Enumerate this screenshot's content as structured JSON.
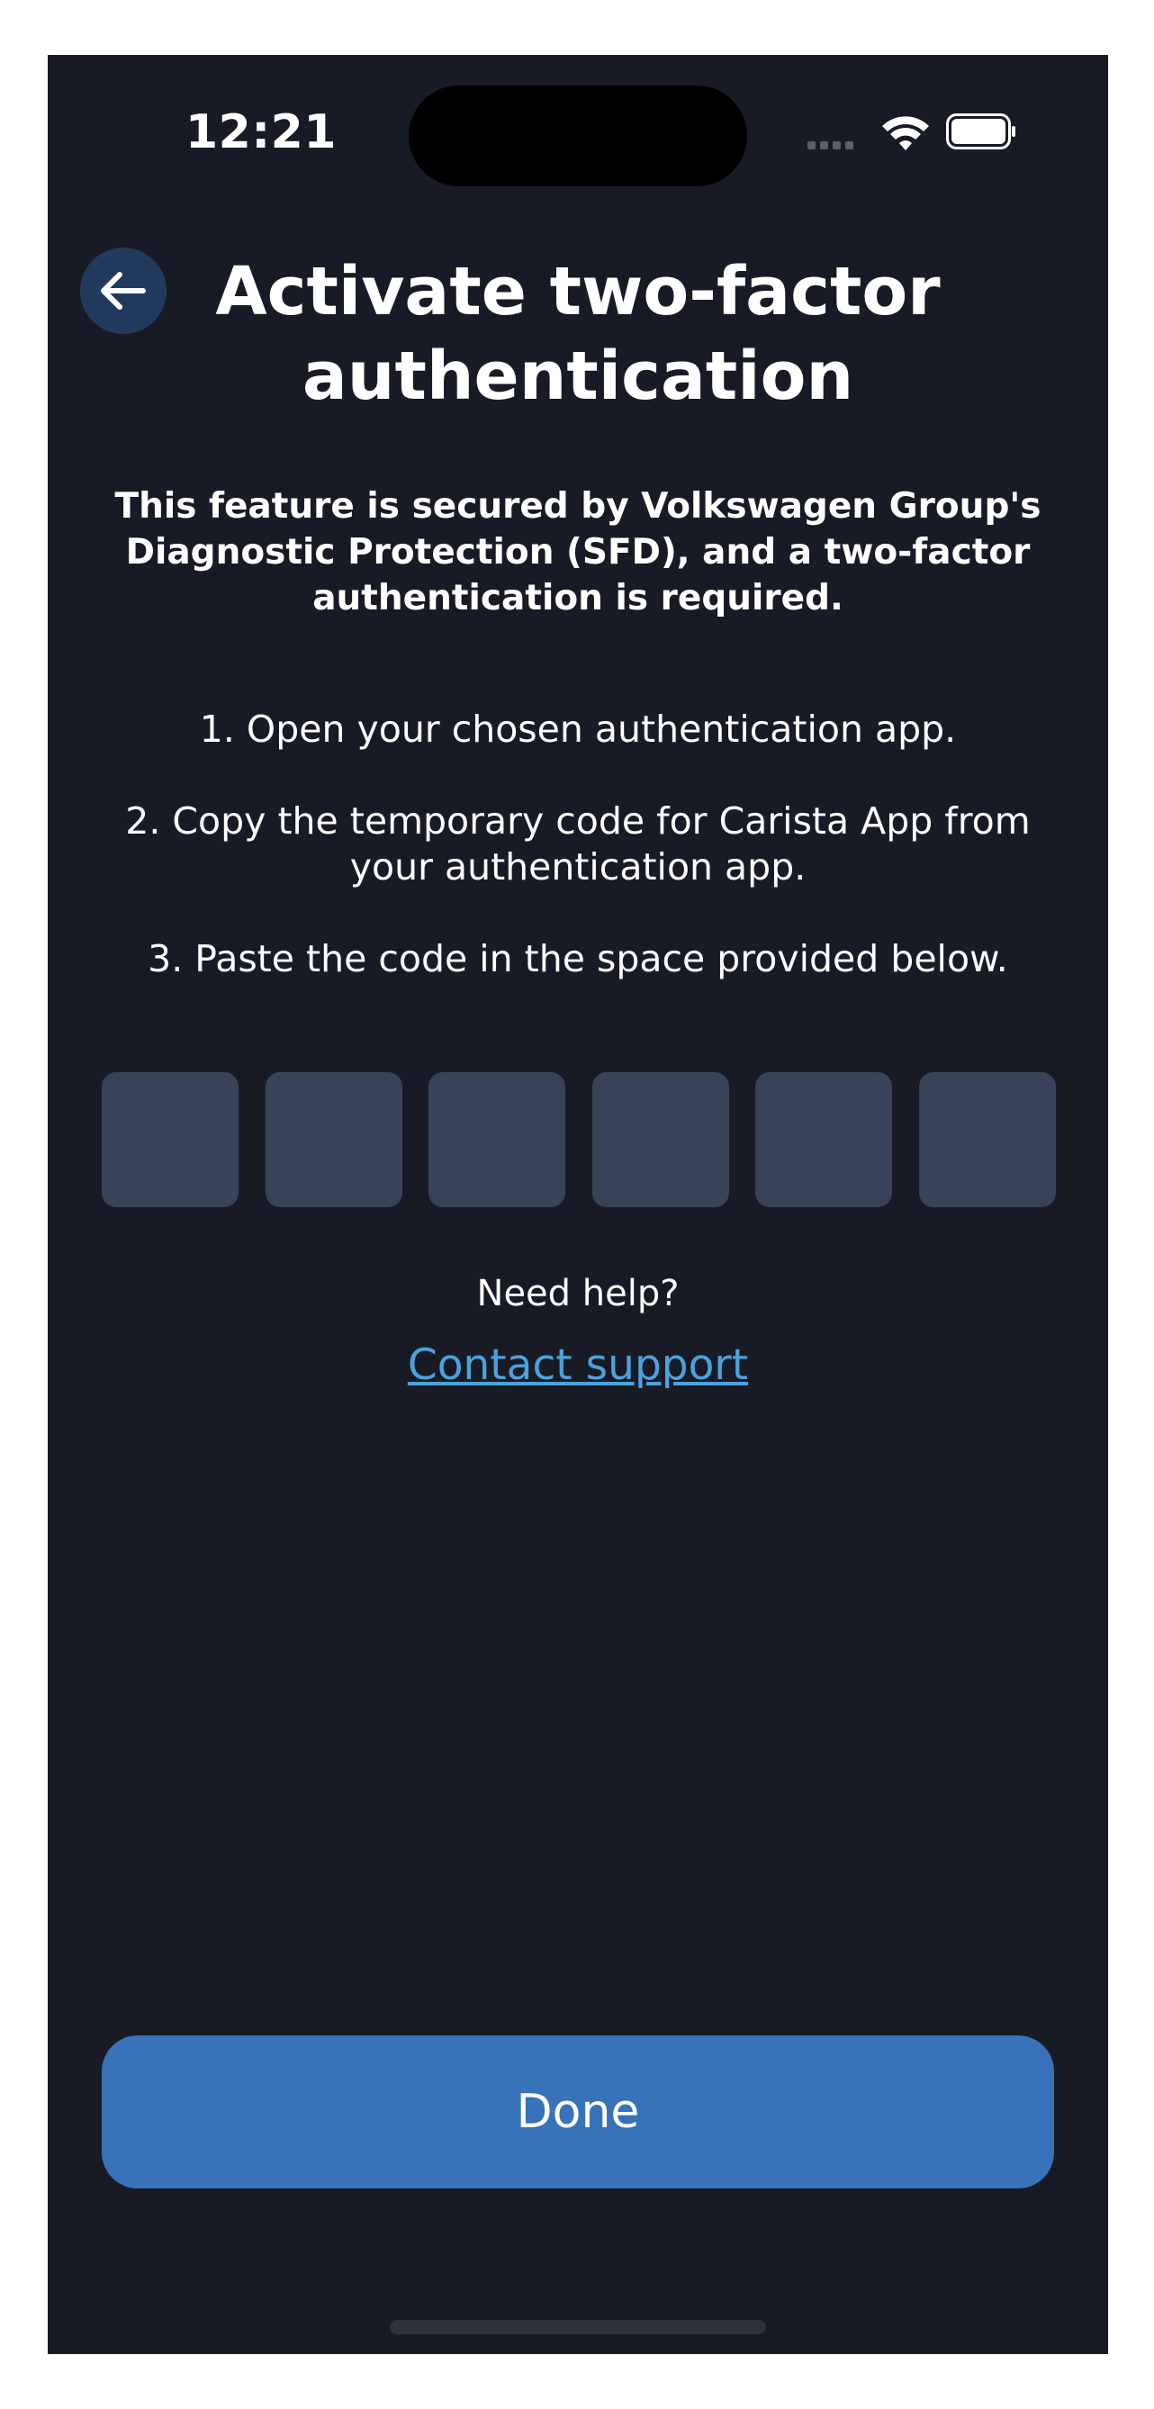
{
  "status_bar": {
    "time": "12:21",
    "signal_icon": "cellular-signal-icon",
    "wifi_icon": "wifi-icon",
    "battery_icon": "battery-icon"
  },
  "header": {
    "back_icon": "arrow-left-icon",
    "title": "Activate two-factor authentication"
  },
  "intro": "This feature is secured by Volkswagen Group's Diagnostic Protection (SFD), and a two-factor authentication is required.",
  "steps": [
    "1. Open your chosen authentication app.",
    "2. Copy the temporary code for Carista App from your authentication app.",
    "3. Paste the code in the space provided below."
  ],
  "code_inputs": [
    "",
    "",
    "",
    "",
    "",
    ""
  ],
  "help": {
    "text": "Need help?",
    "link": "Contact support"
  },
  "done_label": "Done",
  "colors": {
    "background": "#181b25",
    "back_button": "#233a5f",
    "code_box": "#384259",
    "link": "#4aa3dc",
    "primary_button": "#3872b9"
  }
}
